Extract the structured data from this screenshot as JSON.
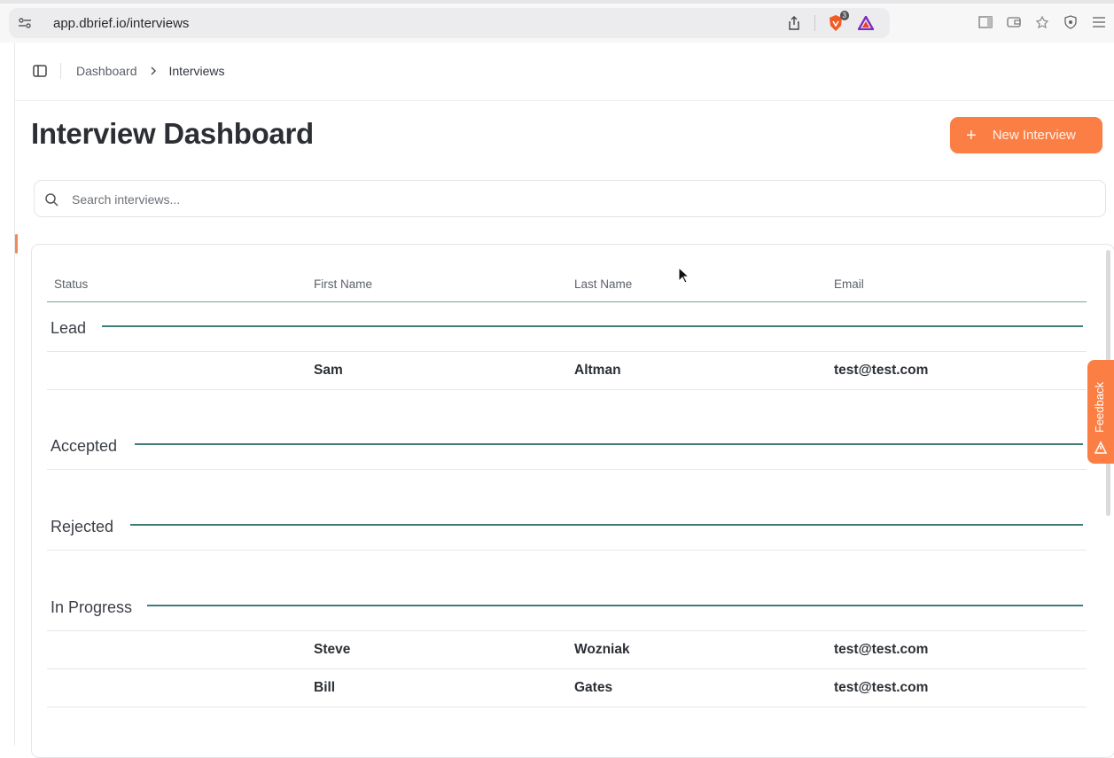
{
  "browser": {
    "url": "app.dbrief.io/interviews",
    "shield_badge": "3",
    "icons": [
      "tune-icon",
      "share-icon",
      "brave-shield-icon",
      "brave-rewards-icon",
      "sidebar-icon",
      "wallet-icon",
      "leo-ai-icon",
      "vpn-icon",
      "menu-icon"
    ]
  },
  "breadcrumb": {
    "parent": "Dashboard",
    "current": "Interviews"
  },
  "page": {
    "title": "Interview Dashboard",
    "new_button": "New Interview",
    "new_button_plus": "+"
  },
  "search": {
    "placeholder": "Search interviews..."
  },
  "table": {
    "columns": [
      "Status",
      "First Name",
      "Last Name",
      "Email"
    ],
    "groups": [
      {
        "label": "Lead",
        "rows": [
          {
            "first": "Sam",
            "last": "Altman",
            "email": "test@test.com"
          }
        ]
      },
      {
        "label": "Accepted",
        "rows": []
      },
      {
        "label": "Rejected",
        "rows": []
      },
      {
        "label": "In Progress",
        "rows": [
          {
            "first": "Steve",
            "last": "Wozniak",
            "email": "test@test.com"
          },
          {
            "first": "Bill",
            "last": "Gates",
            "email": "test@test.com"
          }
        ]
      }
    ]
  },
  "feedback": {
    "label": "Feedback"
  },
  "colors": {
    "accent": "#fb7f45",
    "group_line": "#3f7d7a",
    "header_line": "#7aa3a0"
  }
}
